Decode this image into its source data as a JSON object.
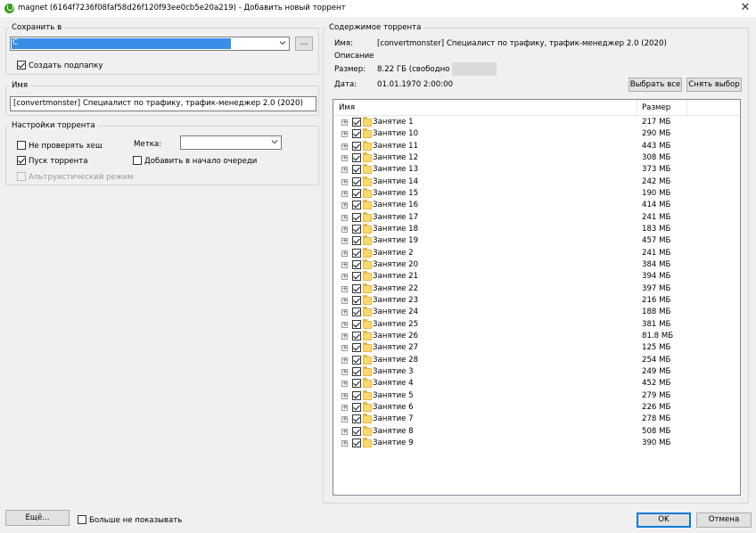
{
  "window": {
    "title": "magnet (6164f7236f08faf58d26f120f93ee0cb5e20a219) - Добавить новый торрент",
    "accent_color": "#3a9d23"
  },
  "save_group": {
    "legend": "Сохранить в",
    "path_value": "C",
    "browse_label": "...",
    "create_subfolder_label": "Создать подпапку",
    "create_subfolder_checked": true
  },
  "name_group": {
    "legend": "Имя",
    "name_value": "[convertmonster] Специалист по трафику, трафик-менеджер 2.0 (2020)"
  },
  "settings_group": {
    "legend": "Настройки торрента",
    "skip_hash_label": "Не проверять хеш",
    "start_torrent_label": "Пуск торрента",
    "altruistic_label": "Альтруистический режим",
    "label_caption": "Метка:",
    "add_to_top_label": "Добавить в начало очереди"
  },
  "content": {
    "legend": "Содержимое торрента",
    "name_caption": "Имя:",
    "name_value": "[convertmonster] Специалист по трафику, трафик-менеджер 2.0 (2020)",
    "description_caption": "Описание",
    "size_caption": "Размер:",
    "size_value": "8.22 ГБ (свободно на д",
    "date_caption": "Дата:",
    "date_value": "01.01.1970 2:00:00",
    "select_all_label": "Выбрать все",
    "deselect_label": "Снять выбор",
    "col_name": "Имя",
    "col_size": "Размер",
    "items": [
      {
        "name": "Занятие 1",
        "size": "217 МБ"
      },
      {
        "name": "Занятие 10",
        "size": "290 МБ"
      },
      {
        "name": "Занятие 11",
        "size": "443 МБ"
      },
      {
        "name": "Занятие 12",
        "size": "308 МБ"
      },
      {
        "name": "Занятие 13",
        "size": "373 МБ"
      },
      {
        "name": "Занятие 14",
        "size": "242 МБ"
      },
      {
        "name": "Занятие 15",
        "size": "190 МБ"
      },
      {
        "name": "Занятие 16",
        "size": "414 МБ"
      },
      {
        "name": "Занятие 17",
        "size": "241 МБ"
      },
      {
        "name": "Занятие 18",
        "size": "183 МБ"
      },
      {
        "name": "Занятие 19",
        "size": "457 МБ"
      },
      {
        "name": "Занятие 2",
        "size": "241 МБ"
      },
      {
        "name": "Занятие 20",
        "size": "384 МБ"
      },
      {
        "name": "Занятие 21",
        "size": "394 МБ"
      },
      {
        "name": "Занятие 22",
        "size": "397 МБ"
      },
      {
        "name": "Занятие 23",
        "size": "216 МБ"
      },
      {
        "name": "Занятие 24",
        "size": "188 МБ"
      },
      {
        "name": "Занятие 25",
        "size": "381 МБ"
      },
      {
        "name": "Занятие 26",
        "size": "81.8 МБ"
      },
      {
        "name": "Занятие 27",
        "size": "125 МБ"
      },
      {
        "name": "Занятие 28",
        "size": "254 МБ"
      },
      {
        "name": "Занятие 3",
        "size": "249 МБ"
      },
      {
        "name": "Занятие 4",
        "size": "452 МБ"
      },
      {
        "name": "Занятие 5",
        "size": "279 МБ"
      },
      {
        "name": "Занятие 6",
        "size": "226 МБ"
      },
      {
        "name": "Занятие 7",
        "size": "278 МБ"
      },
      {
        "name": "Занятие 8",
        "size": "508 МБ"
      },
      {
        "name": "Занятие 9",
        "size": "390 МБ"
      }
    ]
  },
  "footer": {
    "more_label": "Ещё...",
    "dont_show_label": "Больше не показывать",
    "ok_label": "OK",
    "cancel_label": "Отмена"
  }
}
